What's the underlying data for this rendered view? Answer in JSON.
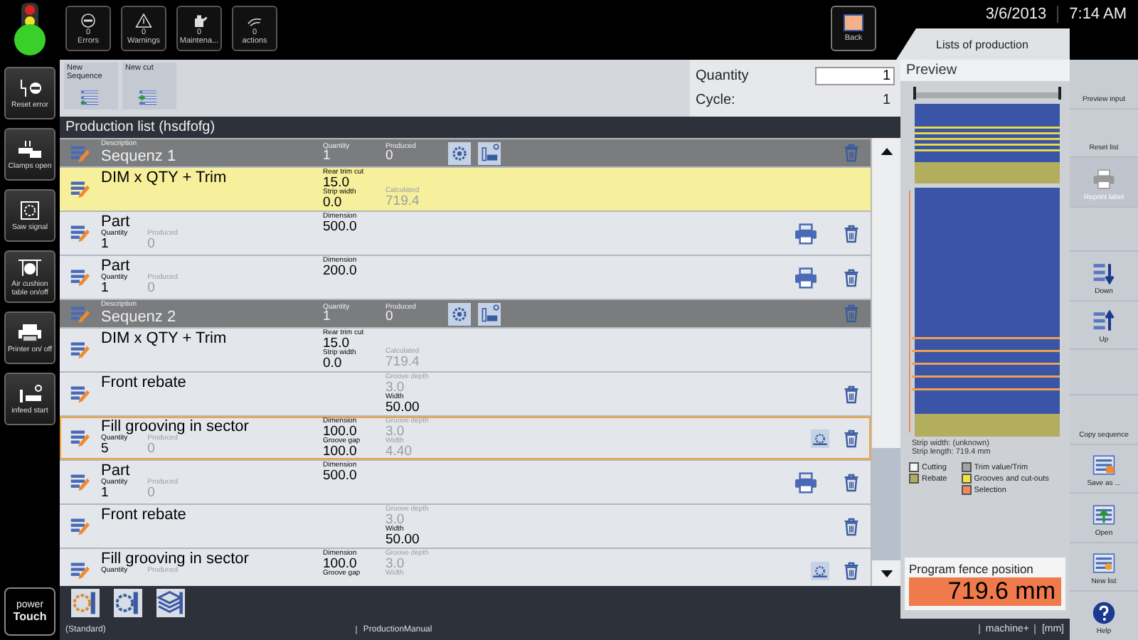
{
  "status_buttons": [
    {
      "label": "Errors",
      "count": "0",
      "kind": "error"
    },
    {
      "label": "Warnings",
      "count": "0",
      "kind": "warning"
    },
    {
      "label": "Maintena...",
      "count": "0",
      "kind": "maintenance"
    },
    {
      "label": "actions",
      "count": "0",
      "kind": "action"
    }
  ],
  "back_button": {
    "label": "Back"
  },
  "date": "3/6/2013",
  "time": "7:14 AM",
  "tab": {
    "label": "Lists of production"
  },
  "side_buttons": [
    {
      "label": "Reset error",
      "kind": "reset"
    },
    {
      "label": "Clamps open",
      "kind": "clamps"
    },
    {
      "label": "Saw signal",
      "kind": "saw"
    },
    {
      "label": "Air cushion table on/off",
      "kind": "air"
    },
    {
      "label": "Printer on/ off",
      "kind": "printer"
    },
    {
      "label": "infeed start",
      "kind": "infeed"
    }
  ],
  "logo": {
    "line_1": "power",
    "line_2": "Touch"
  },
  "toolbar": [
    {
      "label": "New Sequence",
      "kind": "sequence"
    },
    {
      "label": "New cut",
      "kind": "cut"
    }
  ],
  "quantity": {
    "label": "Quantity",
    "value": "1"
  },
  "cycle": {
    "label": "Cycle:",
    "value": "1"
  },
  "list_title": "Production list (hsdfofg)",
  "rows": [
    {
      "kind": "sequence",
      "caption": "Description",
      "title": "Sequenz 1",
      "left": [],
      "mid": [
        {
          "label": "Quantity",
          "value": "1",
          "muted": false
        }
      ],
      "right": [
        {
          "label": "Produced",
          "value": "0",
          "muted": false
        }
      ],
      "deletable": true,
      "active": false,
      "selected": false
    },
    {
      "kind": "trim",
      "title": "DIM x QTY + Trim",
      "left": [],
      "mid": [
        {
          "label": "Rear trim cut",
          "value": "15.0",
          "muted": false
        },
        {
          "label": "Strip width",
          "value": "0.0",
          "muted": false
        }
      ],
      "right": [
        {
          "label": "Calculated",
          "value": "719.4",
          "muted": true
        }
      ],
      "deletable": false,
      "active": true,
      "selected": false
    },
    {
      "kind": "part",
      "title": "Part",
      "left": [
        {
          "label": "Quantity",
          "value": "1",
          "muted": false
        },
        {
          "label": "Produced",
          "value": "0",
          "muted": true
        }
      ],
      "mid": [
        {
          "label": "Dimension",
          "value": "500.0",
          "muted": false
        }
      ],
      "right": [],
      "deletable": true,
      "active": false,
      "selected": false
    },
    {
      "kind": "part",
      "title": "Part",
      "left": [
        {
          "label": "Quantity",
          "value": "1",
          "muted": false
        },
        {
          "label": "Produced",
          "value": "0",
          "muted": true
        }
      ],
      "mid": [
        {
          "label": "Dimension",
          "value": "200.0",
          "muted": false
        }
      ],
      "right": [],
      "deletable": true,
      "active": false,
      "selected": false
    },
    {
      "kind": "sequence",
      "caption": "Description",
      "title": "Sequenz 2",
      "left": [],
      "mid": [
        {
          "label": "Quantity",
          "value": "1",
          "muted": false
        }
      ],
      "right": [
        {
          "label": "Produced",
          "value": "0",
          "muted": false
        }
      ],
      "deletable": true,
      "active": false,
      "selected": false
    },
    {
      "kind": "trim",
      "title": "DIM x QTY + Trim",
      "left": [],
      "mid": [
        {
          "label": "Rear trim cut",
          "value": "15.0",
          "muted": false
        },
        {
          "label": "Strip width",
          "value": "0.0",
          "muted": false
        }
      ],
      "right": [
        {
          "label": "Calculated",
          "value": "719.4",
          "muted": true
        }
      ],
      "deletable": false,
      "active": false,
      "selected": false
    },
    {
      "kind": "rebate",
      "title": "Front rebate",
      "left": [],
      "mid": [],
      "right": [
        {
          "label": "Groove depth",
          "value": "3.0",
          "muted": true
        },
        {
          "label": "Width",
          "value": "50.00",
          "muted": false
        }
      ],
      "deletable": true,
      "active": false,
      "selected": false
    },
    {
      "kind": "groove",
      "title": "Fill grooving in sector",
      "left": [
        {
          "label": "Quantity",
          "value": "5",
          "muted": false
        },
        {
          "label": "Produced",
          "value": "0",
          "muted": true
        }
      ],
      "mid": [
        {
          "label": "Dimension",
          "value": "100.0",
          "muted": false
        },
        {
          "label": "Groove gap",
          "value": "100.0",
          "muted": false
        }
      ],
      "right": [
        {
          "label": "Groove depth",
          "value": "3.0",
          "muted": true
        },
        {
          "label": "Width",
          "value": "4.40",
          "muted": true
        }
      ],
      "deletable": true,
      "active": false,
      "selected": true
    },
    {
      "kind": "part",
      "title": "Part",
      "left": [
        {
          "label": "Quantity",
          "value": "1",
          "muted": false
        },
        {
          "label": "Produced",
          "value": "0",
          "muted": true
        }
      ],
      "mid": [
        {
          "label": "Dimension",
          "value": "500.0",
          "muted": false
        }
      ],
      "right": [],
      "deletable": true,
      "active": false,
      "selected": false
    },
    {
      "kind": "rebate",
      "title": "Front rebate",
      "left": [],
      "mid": [],
      "right": [
        {
          "label": "Groove depth",
          "value": "3.0",
          "muted": true
        },
        {
          "label": "Width",
          "value": "50.00",
          "muted": false
        }
      ],
      "deletable": true,
      "active": false,
      "selected": false
    },
    {
      "kind": "groove",
      "title": "Fill grooving in sector",
      "left": [
        {
          "label": "Quantity",
          "muted": false
        },
        {
          "label": "Produced",
          "muted": true
        }
      ],
      "mid": [
        {
          "label": "Dimension",
          "value": "100.0",
          "muted": false
        },
        {
          "label": "Groove gap",
          "muted": false
        }
      ],
      "right": [
        {
          "label": "Groove depth",
          "value": "3.0",
          "muted": true
        },
        {
          "label": "Width",
          "muted": true
        }
      ],
      "deletable": true,
      "active": false,
      "selected": false
    }
  ],
  "preview": {
    "title": "Preview",
    "strip_width": "Strip width: (unknown)",
    "strip_length": "Strip length: 719.4 mm",
    "legend": [
      {
        "label": "Cutting",
        "color": "#f4f4f4"
      },
      {
        "label": "Rebate",
        "color": "#b3ae5e"
      },
      {
        "label": "Trim value/Trim",
        "color": "#a3a3a3"
      },
      {
        "label": "Grooves and cut-outs",
        "color": "#f2e23a"
      },
      {
        "label": "Selection",
        "color": "#f08a5a"
      }
    ]
  },
  "fence": {
    "label": "Program fence position",
    "value": "719.6 mm"
  },
  "right_buttons": [
    {
      "kind": "text",
      "label": "Preview input",
      "disabled": false
    },
    {
      "kind": "text",
      "label": "Reset list",
      "disabled": false
    },
    {
      "kind": "print",
      "label": "Reprint label",
      "disabled": true
    },
    {
      "kind": "blank"
    },
    {
      "kind": "down",
      "label": "Down",
      "disabled": false
    },
    {
      "kind": "up",
      "label": "Up",
      "disabled": false
    },
    {
      "kind": "blank"
    },
    {
      "kind": "text",
      "label": "Copy sequence",
      "disabled": false
    },
    {
      "kind": "save",
      "label": "Save as ...",
      "disabled": false
    },
    {
      "kind": "open",
      "label": "Open",
      "disabled": false
    },
    {
      "kind": "new",
      "label": "New list",
      "disabled": false
    },
    {
      "kind": "help",
      "label": "Help",
      "disabled": false
    }
  ],
  "status_bar": {
    "profile": "(Standard)",
    "mode": "ProductionManual",
    "machine": "machine+",
    "unit": "[mm]"
  }
}
